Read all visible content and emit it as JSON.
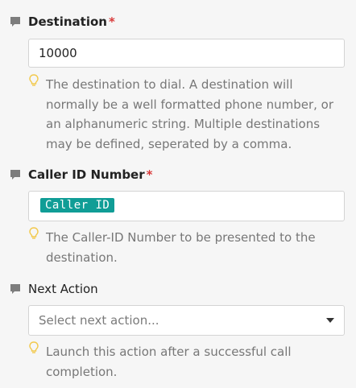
{
  "fields": [
    {
      "label": "Destination",
      "required_mark": "*",
      "value": "10000",
      "hint": "The destination to dial. A destination will normally be a well formatted phone number, or an alphanumeric string. Multiple destinations may be defined, seperated by a comma."
    },
    {
      "label": "Caller ID Number",
      "required_mark": "*",
      "value": "Caller ID",
      "hint": "The Caller-ID Number to be presented to the destination."
    },
    {
      "label": "Next Action",
      "placeholder": "Select next action...",
      "hint": "Launch this action after a successful call completion."
    }
  ],
  "colors": {
    "required": "#d93b3b",
    "chip_background": "#109d96",
    "hint_text": "#777777",
    "bulb": "#f2c94c"
  },
  "icons": {
    "label_icon": "speech-bubble-icon",
    "hint_icon": "lightbulb-icon",
    "dropdown_icon": "caret-down-icon"
  }
}
